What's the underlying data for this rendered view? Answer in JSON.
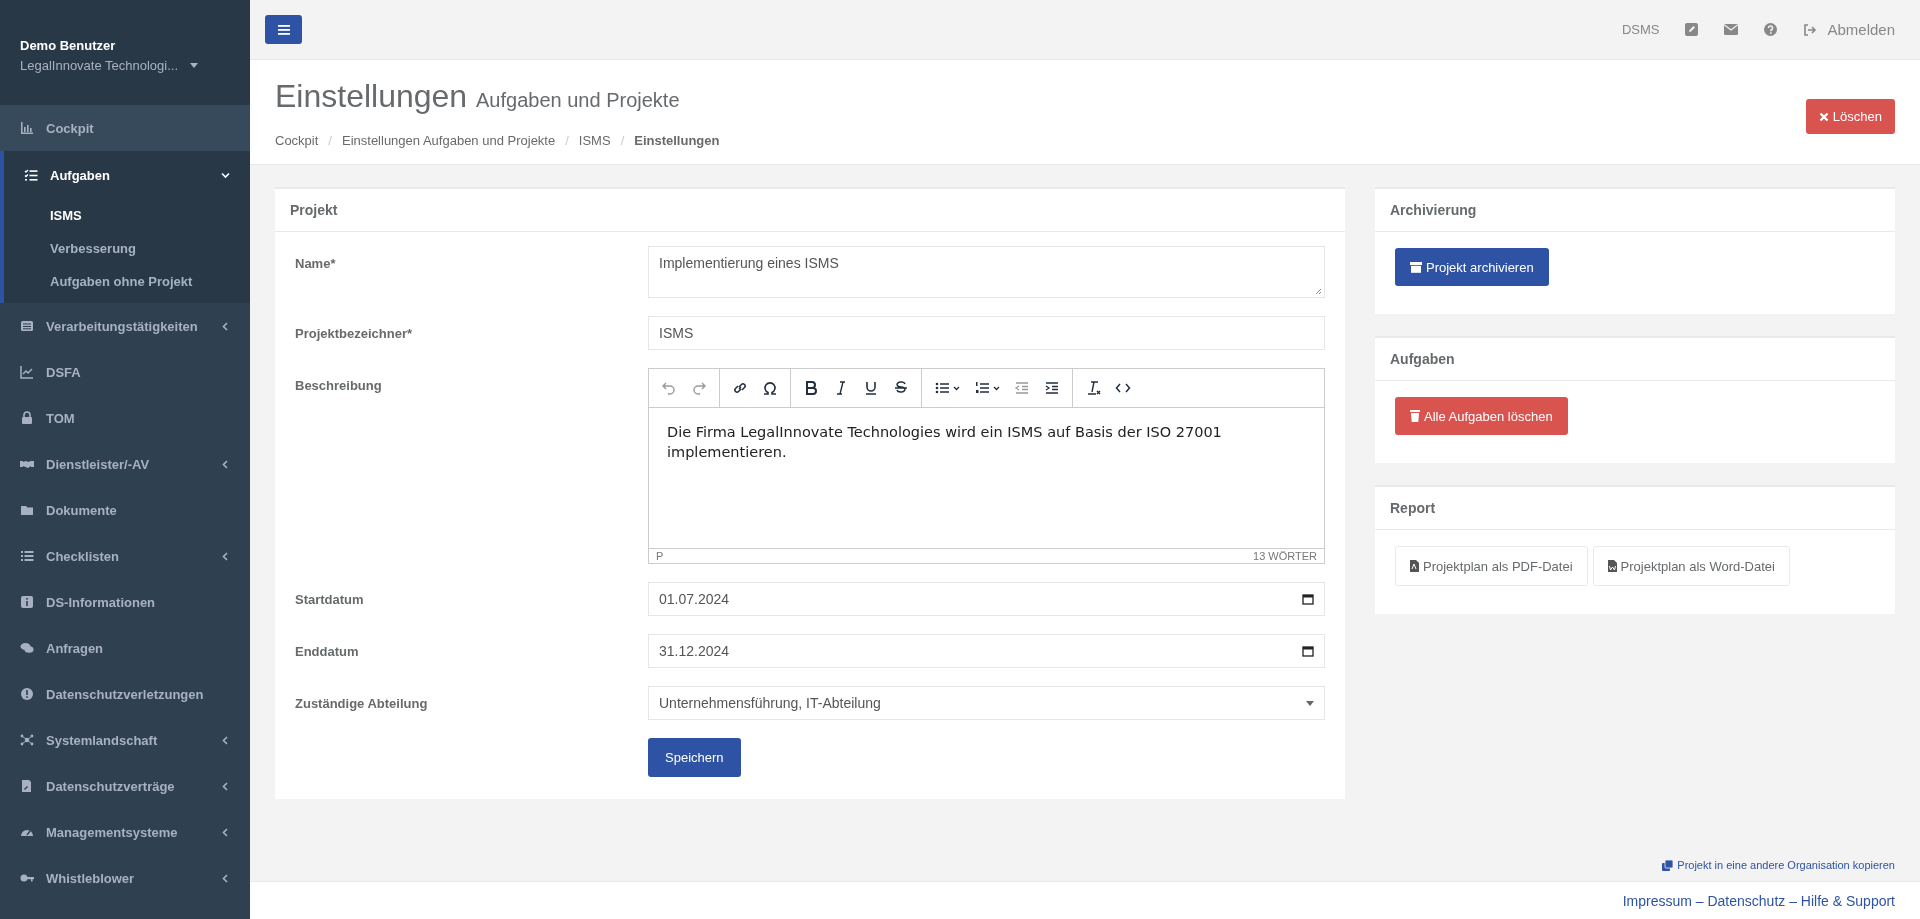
{
  "sidebar": {
    "user_name": "Demo Benutzer",
    "organization": "LegalInnovate Technologi...",
    "items": [
      {
        "label": "Cockpit",
        "kind": "link",
        "selected": false,
        "hovered": true
      },
      {
        "label": "Aufgaben",
        "kind": "menu",
        "selected": true,
        "hovered": false,
        "expanded": true,
        "children": [
          {
            "label": "ISMS",
            "selected": true
          },
          {
            "label": "Verbesserung",
            "selected": false
          },
          {
            "label": "Aufgaben ohne Projekt",
            "selected": false
          }
        ]
      },
      {
        "label": "Verarbeitungstätigkeiten",
        "kind": "menu",
        "selected": false,
        "hovered": false,
        "expanded": false
      },
      {
        "label": "DSFA",
        "kind": "link",
        "selected": false,
        "hovered": false
      },
      {
        "label": "TOM",
        "kind": "link",
        "selected": false,
        "hovered": false
      },
      {
        "label": "Dienstleister/-AV",
        "kind": "menu",
        "selected": false,
        "hovered": false,
        "expanded": false
      },
      {
        "label": "Dokumente",
        "kind": "link",
        "selected": false,
        "hovered": false
      },
      {
        "label": "Checklisten",
        "kind": "menu",
        "selected": false,
        "hovered": false,
        "expanded": false
      },
      {
        "label": "DS-Informationen",
        "kind": "link",
        "selected": false,
        "hovered": false
      },
      {
        "label": "Anfragen",
        "kind": "link",
        "selected": false,
        "hovered": false
      },
      {
        "label": "Datenschutzverletzungen",
        "kind": "link",
        "selected": false,
        "hovered": false
      },
      {
        "label": "Systemlandschaft",
        "kind": "menu",
        "selected": false,
        "hovered": false,
        "expanded": false
      },
      {
        "label": "Datenschutzverträge",
        "kind": "menu",
        "selected": false,
        "hovered": false,
        "expanded": false
      },
      {
        "label": "Managementsysteme",
        "kind": "menu",
        "selected": false,
        "hovered": false,
        "expanded": false
      },
      {
        "label": "Whistleblower",
        "kind": "menu",
        "selected": false,
        "hovered": false,
        "expanded": false
      }
    ]
  },
  "top_bar": {
    "app_label": "DSMS",
    "logout": "Abmelden"
  },
  "header": {
    "title": "Einstellungen",
    "subtitle": "Aufgaben und Projekte",
    "delete_button": "Löschen",
    "breadcrumb": [
      {
        "label": "Cockpit",
        "selected": false
      },
      {
        "label": "Einstellungen Aufgaben und Projekte",
        "selected": false
      },
      {
        "label": "ISMS",
        "selected": false
      },
      {
        "label": "Einstellungen",
        "selected": true
      }
    ],
    "separator": "/"
  },
  "project_card": {
    "title": "Projekt",
    "fields": [
      {
        "kind": "textarea",
        "label": "Name*",
        "value": "Implementierung eines ISMS"
      },
      {
        "kind": "text",
        "label": "Projektbezeichner*",
        "value": "ISMS"
      },
      {
        "kind": "editor",
        "label": "Beschreibung",
        "value": "Die Firma LegalInnovate Technologies wird ein ISMS auf Basis der ISO 27001 implementieren.",
        "element_path": "P",
        "word_count": "13 WÖRTER"
      },
      {
        "kind": "date",
        "label": "Startdatum",
        "value": "01.07.2024"
      },
      {
        "kind": "date",
        "label": "Enddatum",
        "value": "31.12.2024"
      },
      {
        "kind": "select",
        "label": "Zuständige Abteilung",
        "value": "Unternehmensführung, IT-Abteilung"
      }
    ],
    "save_button": "Speichern"
  },
  "side_cards": [
    {
      "title": "Archivierung",
      "buttons": [
        {
          "kind": "primary",
          "label": "Projekt archivieren"
        }
      ]
    },
    {
      "title": "Aufgaben",
      "buttons": [
        {
          "kind": "danger",
          "label": "Alle Aufgaben löschen"
        }
      ]
    },
    {
      "title": "Report",
      "buttons": [
        {
          "kind": "pdf",
          "label": "Projektplan als PDF-Datei"
        },
        {
          "kind": "word",
          "label": "Projektplan als Word-Datei"
        }
      ]
    }
  ],
  "copy_link": "Projekt in eine andere Organisation kopieren",
  "footer": "Impressum – Datenschutz – Hilfe & Support"
}
